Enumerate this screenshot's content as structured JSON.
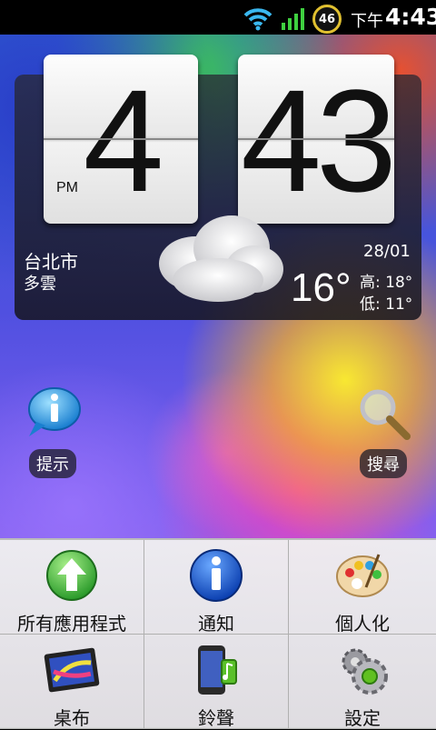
{
  "status_bar": {
    "battery": "46",
    "ampm": "下午",
    "time": "4:43"
  },
  "clock": {
    "hour": "4",
    "minute": "43",
    "ampm": "PM"
  },
  "weather": {
    "city": "台北市",
    "condition": "多雲",
    "date": "28/01",
    "temperature": "16°",
    "high": "高: 18°",
    "low": "低: 11°"
  },
  "shortcuts": {
    "tips": "提示",
    "search": "搜尋"
  },
  "menu": {
    "items": [
      {
        "label": "所有應用程式",
        "icon": "all-apps-icon"
      },
      {
        "label": "通知",
        "icon": "notifications-icon"
      },
      {
        "label": "個人化",
        "icon": "personalize-icon"
      },
      {
        "label": "桌布",
        "icon": "wallpaper-icon"
      },
      {
        "label": "鈴聲",
        "icon": "ringtone-icon"
      },
      {
        "label": "設定",
        "icon": "settings-icon"
      }
    ]
  },
  "colors": {
    "status_bg": "#000000",
    "menu_bg": "#e8e8e8",
    "accent_green": "#3aa63a",
    "accent_blue": "#1e5ed8"
  }
}
